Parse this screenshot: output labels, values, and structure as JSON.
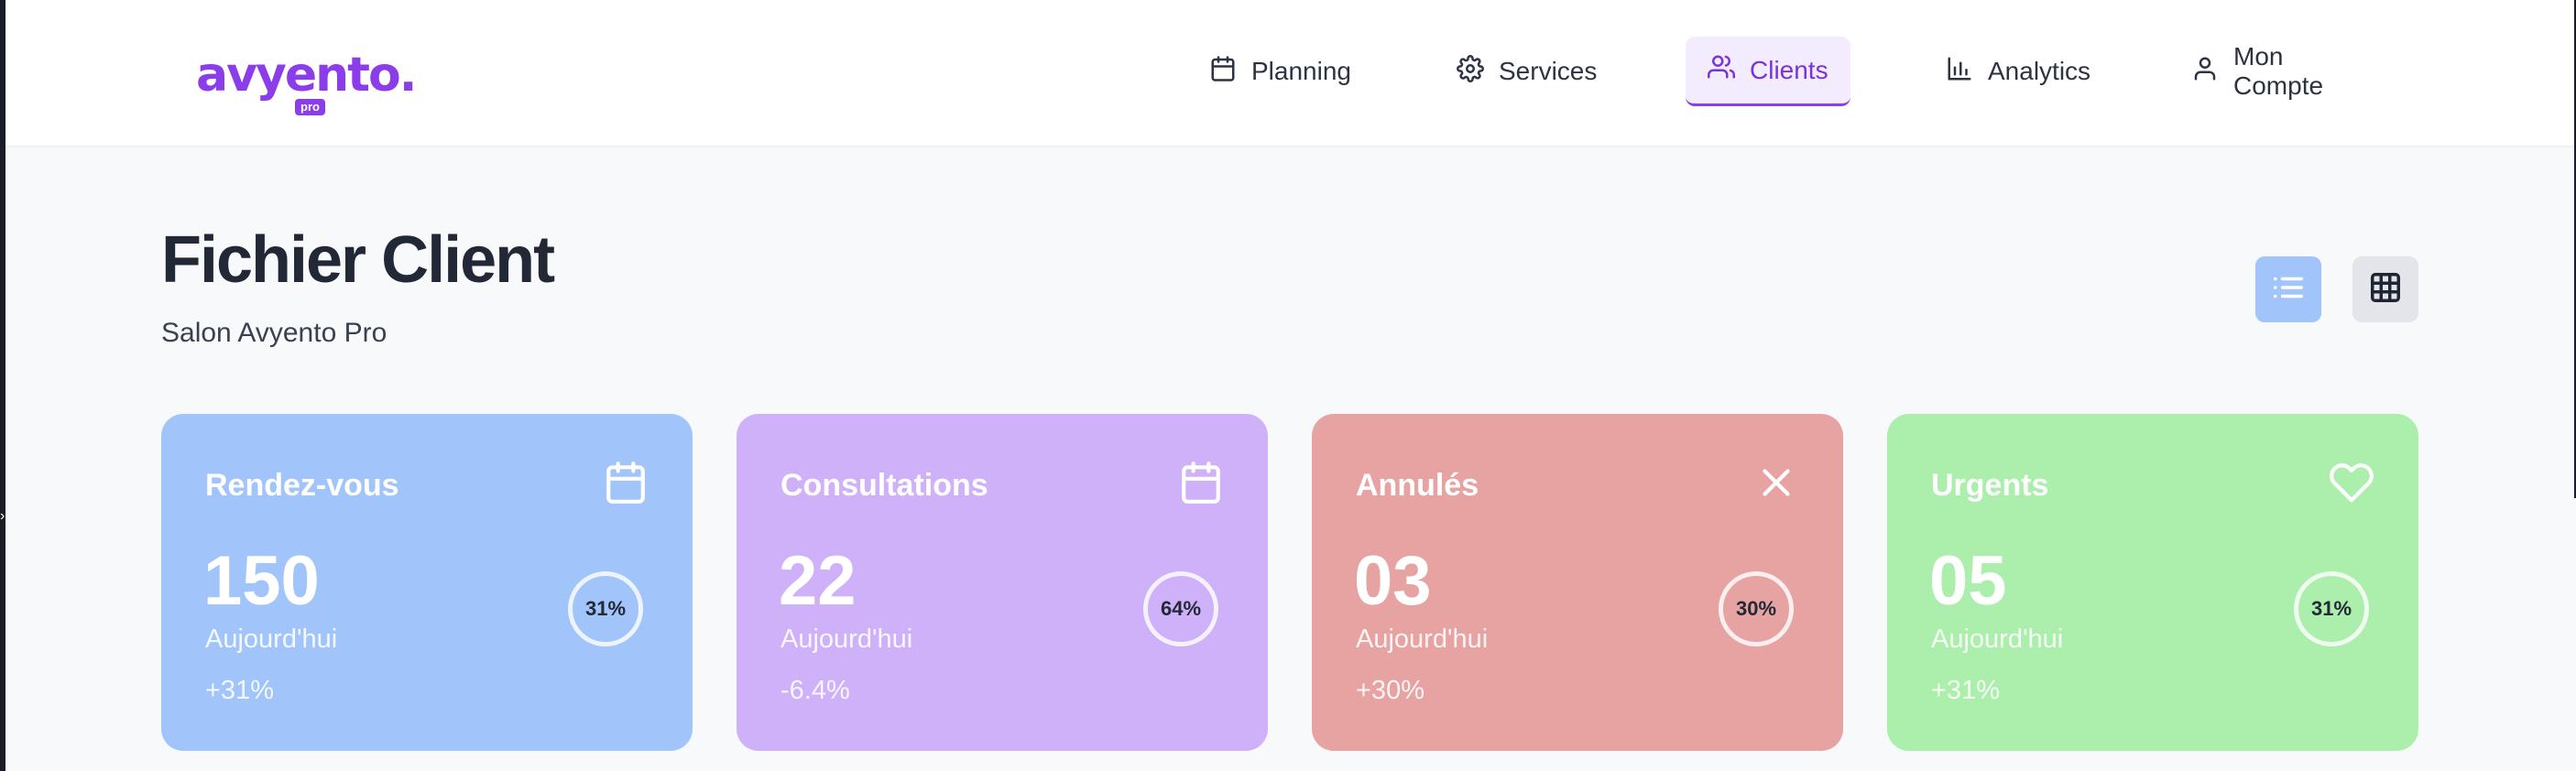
{
  "logo": {
    "name": "avyento.",
    "badge": "pro"
  },
  "nav": {
    "items": [
      {
        "label": "Planning",
        "icon": "calendar-icon",
        "active": false
      },
      {
        "label": "Services",
        "icon": "gear-icon",
        "active": false
      },
      {
        "label": "Clients",
        "icon": "users-icon",
        "active": true
      },
      {
        "label": "Analytics",
        "icon": "bar-chart-icon",
        "active": false
      },
      {
        "label": "Mon Compte",
        "icon": "user-icon",
        "active": false
      }
    ]
  },
  "page": {
    "title": "Fichier Client",
    "subtitle": "Salon Avyento Pro"
  },
  "view_toggle": {
    "list_icon": "list-icon",
    "grid_icon": "grid-icon",
    "active": "list"
  },
  "stats": [
    {
      "title": "Rendez-vous",
      "icon": "calendar-icon",
      "value": "150",
      "caption": "Aujourd'hui",
      "delta": "+31%",
      "percent": "31%",
      "color": "#a1c4fa"
    },
    {
      "title": "Consultations",
      "icon": "calendar-icon",
      "value": "22",
      "caption": "Aujourd'hui",
      "delta": "-6.4%",
      "percent": "64%",
      "color": "#ceb1f9"
    },
    {
      "title": "Annulés",
      "icon": "close-icon",
      "value": "03",
      "caption": "Aujourd'hui",
      "delta": "+30%",
      "percent": "30%",
      "color": "#e6a3a2"
    },
    {
      "title": "Urgents",
      "icon": "heart-icon",
      "value": "05",
      "caption": "Aujourd'hui",
      "delta": "+31%",
      "percent": "31%",
      "color": "#acefad"
    }
  ],
  "colors": {
    "accent": "#8b3dea",
    "active_nav_bg": "#f3ecfe",
    "page_bg": "#f8f9fb"
  }
}
